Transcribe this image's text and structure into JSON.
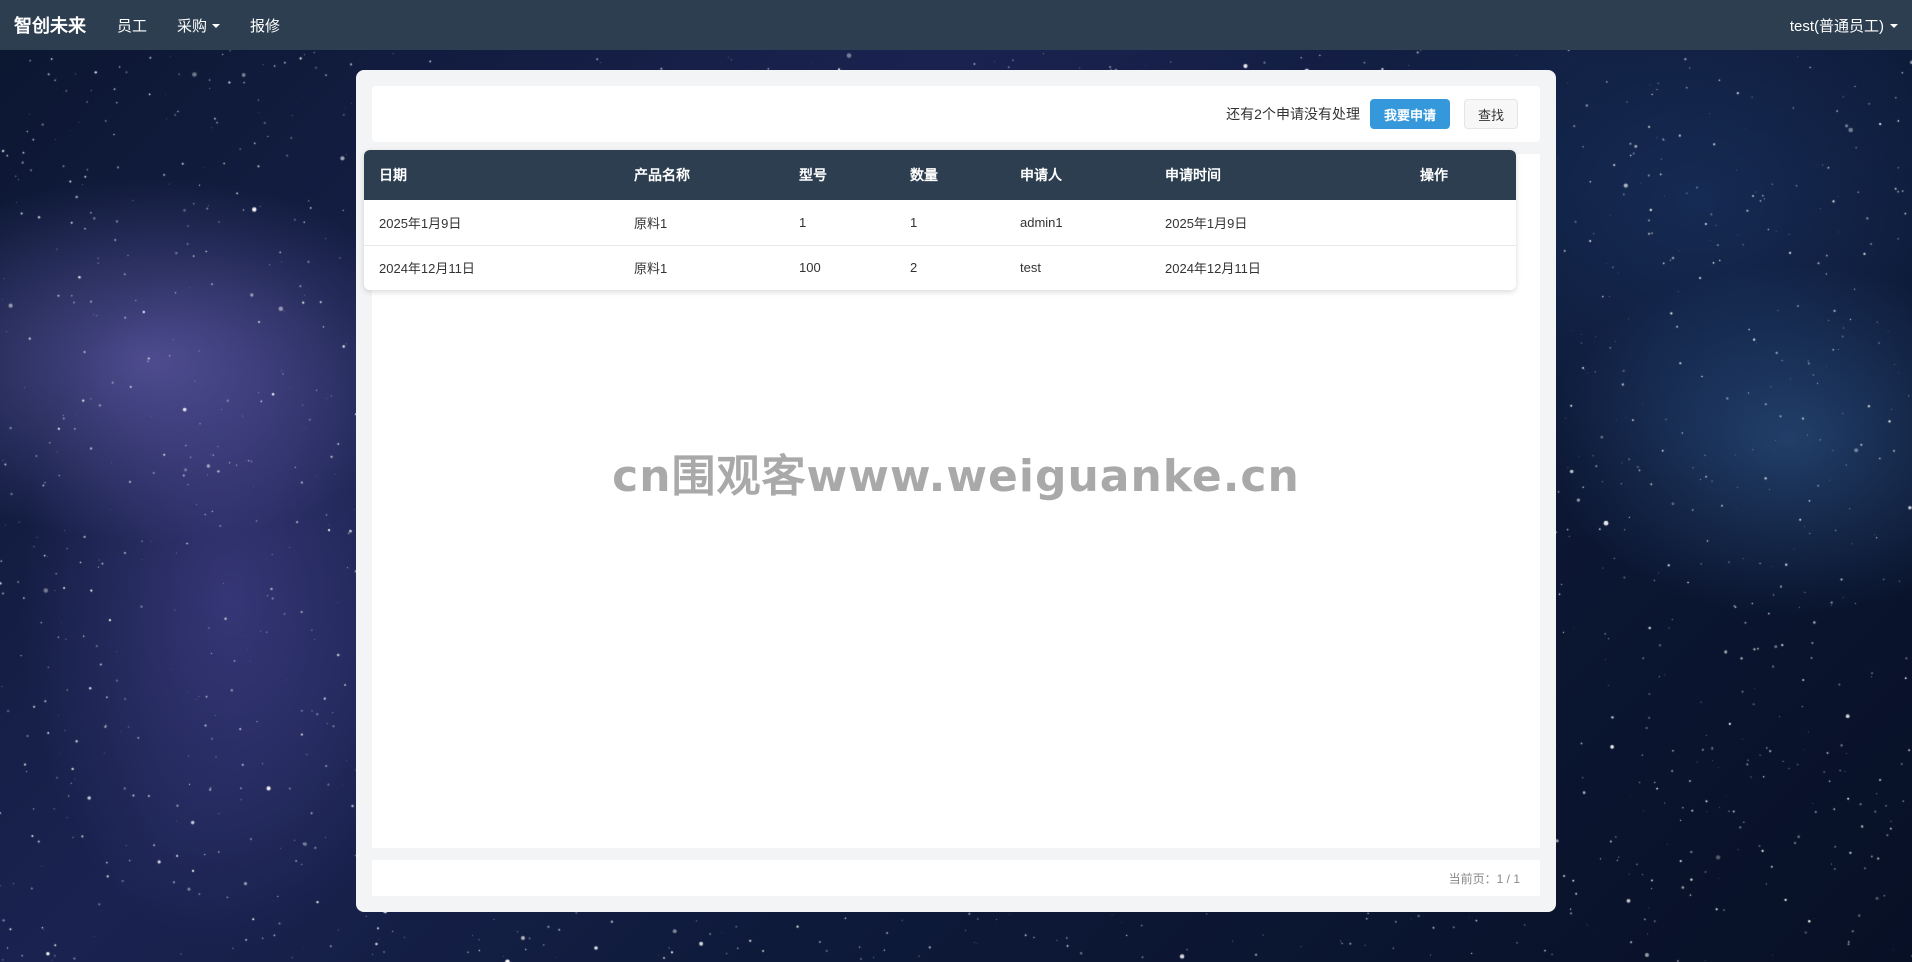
{
  "navbar": {
    "brand": "智创未来",
    "items": [
      {
        "label": "员工",
        "dropdown": false
      },
      {
        "label": "采购",
        "dropdown": true
      },
      {
        "label": "报修",
        "dropdown": false
      }
    ],
    "user": "test(普通员工)",
    "bg_color": "#2c3e50"
  },
  "toolbar": {
    "pending_text": "还有2个申请没有处理",
    "apply_button": "我要申请",
    "search_button": "查找",
    "accent_color": "#3498db"
  },
  "table": {
    "headers": [
      "日期",
      "产品名称",
      "型号",
      "数量",
      "申请人",
      "申请时间",
      "操作"
    ],
    "rows": [
      [
        "2025年1月9日",
        "原料1",
        "1",
        "1",
        "admin1",
        "2025年1月9日",
        ""
      ],
      [
        "2024年12月11日",
        "原料1",
        "100",
        "2",
        "test",
        "2024年12月11日",
        ""
      ]
    ]
  },
  "watermark": "cn围观客www.weiguanke.cn",
  "pagination": {
    "text": "当前页：1 / 1"
  }
}
